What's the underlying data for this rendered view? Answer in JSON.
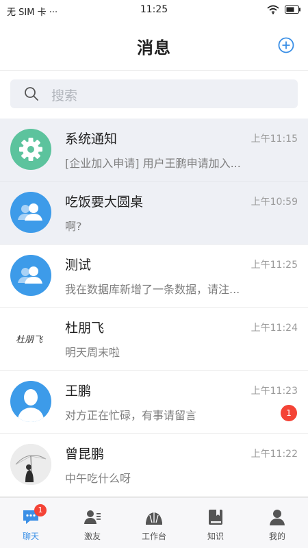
{
  "status_bar": {
    "carrier": "无 SIM 卡 ···",
    "time": "11:25"
  },
  "header": {
    "title": "消息"
  },
  "search": {
    "placeholder": "搜索"
  },
  "conversations": [
    {
      "name": "系统通知",
      "time": "上午11:15",
      "preview": "[企业加入申请] 用户王鹏申请加入...",
      "avatar": "gear-icon",
      "pinned": true
    },
    {
      "name": "吃饭要大圆桌",
      "time": "上午10:59",
      "preview": "啊?",
      "avatar": "group-icon",
      "pinned": true
    },
    {
      "name": "测试",
      "time": "上午11:25",
      "preview": "我在数据库新增了一条数据，请注...",
      "avatar": "group-icon",
      "pinned": false
    },
    {
      "name": "杜朋飞",
      "time": "上午11:24",
      "preview": "明天周末啦",
      "avatar": "signature-avatar",
      "avatar_text": "杜朋飞",
      "pinned": false
    },
    {
      "name": "王鹏",
      "time": "上午11:23",
      "preview": "对方正在忙碌，有事请留言",
      "avatar": "person-icon",
      "unread": "1",
      "pinned": false
    },
    {
      "name": "曾昆鹏",
      "time": "上午11:22",
      "preview": "中午吃什么呀",
      "avatar": "photo-avatar",
      "pinned": false
    }
  ],
  "tabbar": {
    "items": [
      {
        "label": "聊天",
        "icon": "chat-icon",
        "badge": "1",
        "active": true
      },
      {
        "label": "激友",
        "icon": "contacts-icon",
        "active": false
      },
      {
        "label": "工作台",
        "icon": "workbench-icon",
        "active": false
      },
      {
        "label": "知识",
        "icon": "book-icon",
        "active": false
      },
      {
        "label": "我的",
        "icon": "profile-icon",
        "active": false
      }
    ]
  },
  "colors": {
    "accent": "#3a8fe6",
    "avatar_blue": "#3d9be9",
    "system_green": "#5cc39d",
    "badge_red": "#f44336",
    "pinned_bg": "#eef0f5"
  }
}
